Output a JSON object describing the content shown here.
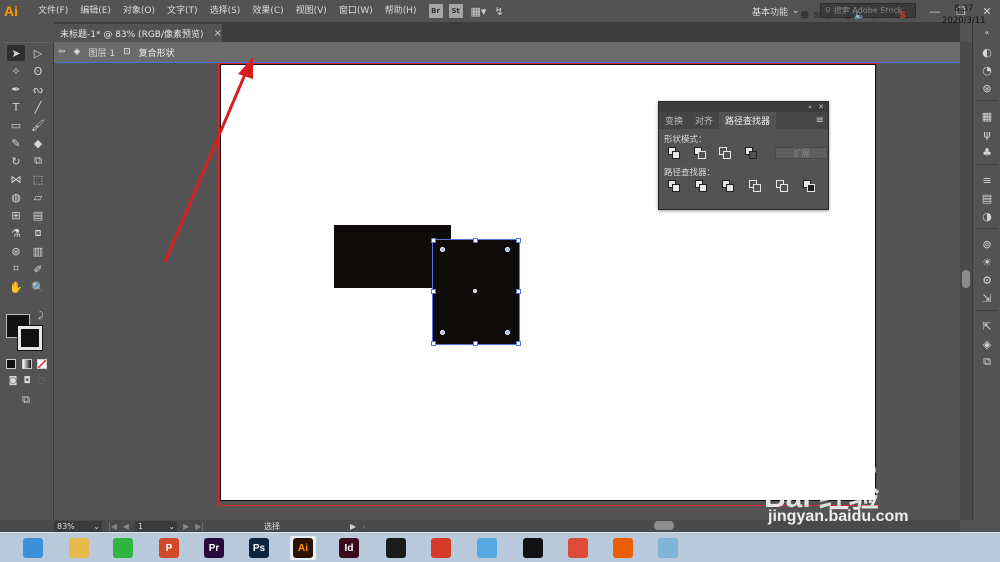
{
  "app": {
    "logo": "Ai",
    "menu": [
      "文件(F)",
      "编辑(E)",
      "对象(O)",
      "文字(T)",
      "选择(S)",
      "效果(C)",
      "视图(V)",
      "窗口(W)",
      "帮助(H)"
    ],
    "bridge_badge": "Br",
    "stock_badge": "St",
    "workspace": "基本功能",
    "stock_search_placeholder": "搜索 Adobe Stock"
  },
  "document": {
    "tab_title": "未标题-1* @ 83% (RGB/像素预览)",
    "close_glyph": "×"
  },
  "isolation": {
    "layer": "图层 1",
    "group": "复合形状"
  },
  "pathfinder": {
    "tabs": [
      "变换",
      "对齐",
      "路径查找器"
    ],
    "active_tab": 2,
    "shape_modes_label": "形状模式：",
    "expand_label": "扩展",
    "pathfinders_label": "路径查找器："
  },
  "status": {
    "zoom": "83%",
    "artboard": "1",
    "tool": "选择"
  },
  "taskbar": {
    "apps": [
      {
        "name": "browser",
        "label": "",
        "color": "#3b8fd6"
      },
      {
        "name": "explorer",
        "label": "",
        "color": "#e8b84a"
      },
      {
        "name": "wechat",
        "label": "",
        "color": "#2fb53f"
      },
      {
        "name": "powerpoint",
        "label": "P",
        "color": "#d24726"
      },
      {
        "name": "premiere",
        "label": "Pr",
        "color": "#2a0a3a"
      },
      {
        "name": "photoshop",
        "label": "Ps",
        "color": "#0b2740"
      },
      {
        "name": "illustrator",
        "label": "Ai",
        "color": "#2b1400"
      },
      {
        "name": "indesign",
        "label": "Id",
        "color": "#3a0a1e"
      },
      {
        "name": "video",
        "label": "",
        "color": "#1a1a1a"
      },
      {
        "name": "app-red",
        "label": "",
        "color": "#d83a2a"
      },
      {
        "name": "app-bird",
        "label": "",
        "color": "#58a7e0"
      },
      {
        "name": "qq",
        "label": "",
        "color": "#111111"
      },
      {
        "name": "chrome",
        "label": "",
        "color": "#dd4b39"
      },
      {
        "name": "firefox",
        "label": "",
        "color": "#e66000"
      },
      {
        "name": "app-doc",
        "label": "",
        "color": "#7fb3d5"
      }
    ],
    "time": "8:37",
    "date": "2020/3/11"
  },
  "watermark": {
    "brand": "Bai 经验",
    "url": "jingyan.baidu.com"
  },
  "colors": {
    "accent": "#ff9a00",
    "selection": "#5874e0",
    "bleed": "#d8262f",
    "arrow": "#d62020"
  }
}
